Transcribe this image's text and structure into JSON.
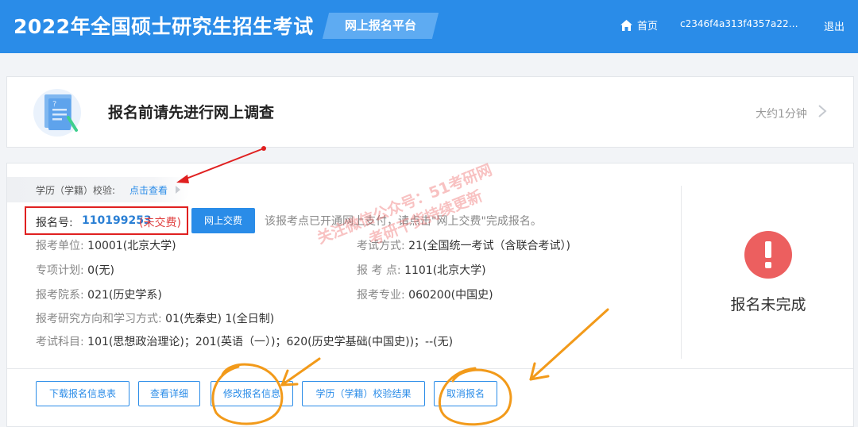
{
  "header": {
    "title": "2022年全国硕士研究生招生考试",
    "platform": "网上报名平台",
    "home_label": "首页",
    "user_id": "c2346f4a313f4357a2294…",
    "logout_label": "退出"
  },
  "survey": {
    "text": "报名前请先进行网上调查",
    "duration": "大约1分钟"
  },
  "verify": {
    "label": "学历（学籍）校验:",
    "link": "点击查看"
  },
  "registration": {
    "number_label": "报名号:",
    "number": "110199253",
    "pay_status": "(未交费)",
    "pay_button": "网上交费",
    "pay_note": "该报考点已开通网上支付，请点击\"网上交费\"完成报名。"
  },
  "details": {
    "unit_label": "报考单位:",
    "unit_value": "10001(北京大学)",
    "exam_mode_label": "考试方式:",
    "exam_mode_value": "21(全国统一考试（含联合考试）)",
    "plan_label": "专项计划:",
    "plan_value": "0(无)",
    "site_label": "报 考 点:",
    "site_value": "1101(北京大学)",
    "dept_label": "报考院系:",
    "dept_value": "021(历史学系)",
    "major_label": "报考专业:",
    "major_value": "060200(中国史)",
    "direction_label": "报考研究方向和学习方式:",
    "direction_value": "01(先秦史) 1(全日制)",
    "subjects_label": "考试科目:",
    "subjects_value": "101(思想政治理论)；201(英语（一）)；620(历史学基础(中国史))；--(无)"
  },
  "status": {
    "text": "报名未完成"
  },
  "actions": {
    "download": "下载报名信息表",
    "view_detail": "查看详细",
    "modify": "修改报名信息",
    "verify_result": "学历（学籍）校验结果",
    "cancel": "取消报名"
  },
  "watermark": {
    "line1": "关注微信公众号：51考研网",
    "line2": "考研干货持续更新"
  },
  "colors": {
    "primary": "#2a8ce8",
    "error": "#ec5f5f",
    "annotation_red": "#e02020",
    "annotation_orange": "#f29a1a"
  }
}
